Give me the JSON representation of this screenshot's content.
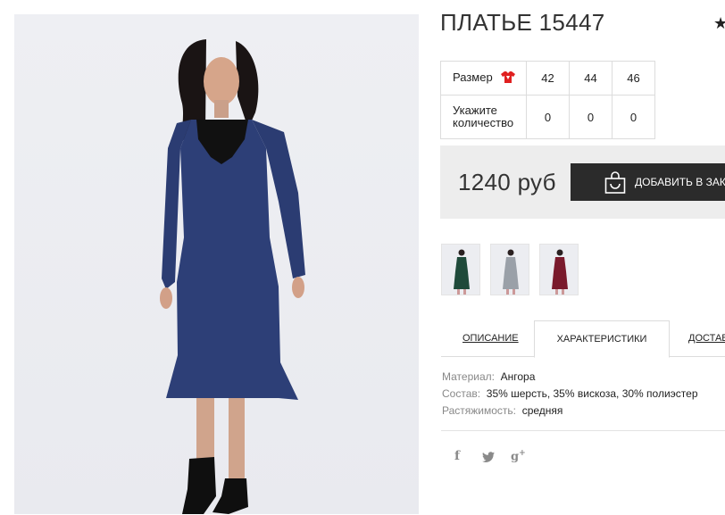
{
  "product": {
    "title": "ПЛАТЬЕ 15447",
    "photo_alt": "woman in navy knit dress"
  },
  "sizes": {
    "size_label": "Размер",
    "qty_label": "Укажите количество",
    "values": [
      "42",
      "44",
      "46"
    ],
    "quantities": [
      "0",
      "0",
      "0"
    ]
  },
  "buy": {
    "price": "1240 руб",
    "add_label": "ДОБАВИТЬ В ЗАКАЗ"
  },
  "thumbnails": [
    {
      "color": "#1f4a3a"
    },
    {
      "color": "#9aa0a8"
    },
    {
      "color": "#7a1a2c"
    }
  ],
  "tabs": [
    "ОПИСАНИЕ",
    "ХАРАКТЕРИСТИКИ",
    "ДОСТАВКА"
  ],
  "active_tab": 1,
  "specs": [
    {
      "key": "Материал:",
      "value": "Ангора"
    },
    {
      "key": "Состав:",
      "value": "35% шерсть, 35% вискоза, 30% полиэстер"
    },
    {
      "key": "Растяжимость:",
      "value": "средняя"
    }
  ],
  "social": [
    "facebook-icon",
    "twitter-icon",
    "google-plus-icon"
  ],
  "colors": {
    "accent_dark": "#2b2b2b",
    "buy_box_bg": "#ededed",
    "shirt_icon": "#e02020"
  }
}
